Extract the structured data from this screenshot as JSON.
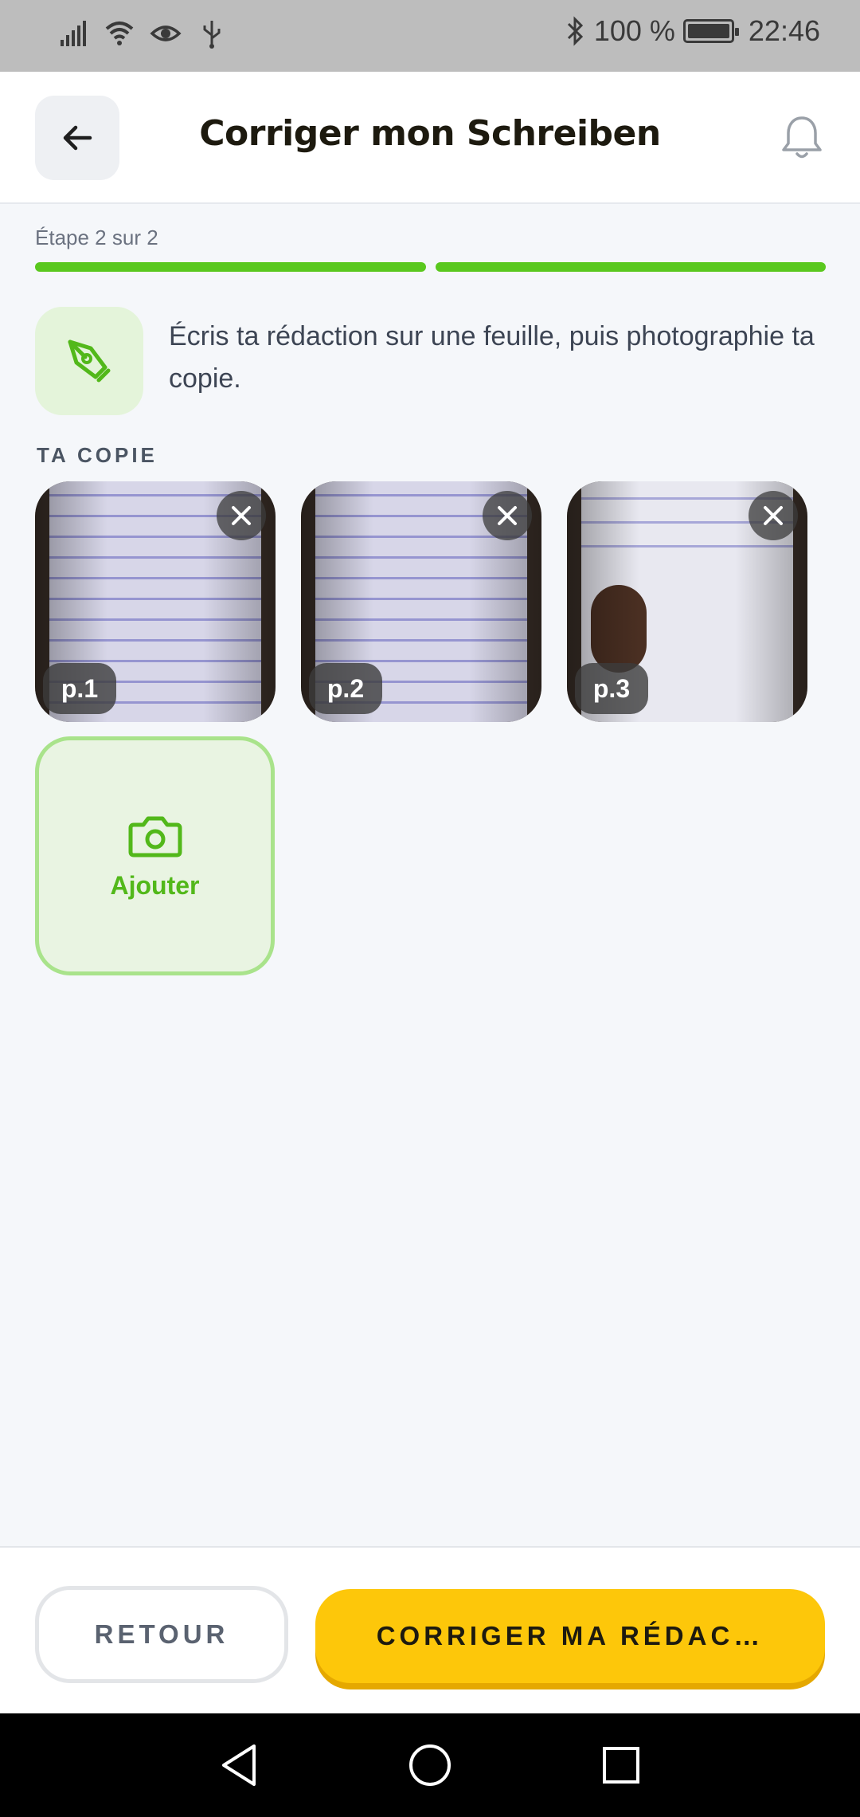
{
  "status_bar": {
    "battery": "100 %",
    "time": "22:46",
    "icons": [
      "signal-icon",
      "wifi-icon",
      "eye-icon",
      "usb-icon",
      "bluetooth-icon",
      "battery-icon"
    ]
  },
  "header": {
    "title": "Corriger mon Schreiben",
    "back_icon": "arrow-left-icon",
    "notification_icon": "bell-icon"
  },
  "step": {
    "label": "Étape 2 sur 2",
    "current": 2,
    "total": 2
  },
  "instruction": {
    "icon": "pen-nib-icon",
    "text": "Écris ta rédaction sur une feuille, puis photographie ta copie."
  },
  "copy_section": {
    "label": "TA COPIE",
    "pages": [
      {
        "badge": "p.1"
      },
      {
        "badge": "p.2"
      },
      {
        "badge": "p.3"
      }
    ],
    "add_label": "Ajouter",
    "add_icon": "camera-icon"
  },
  "actions": {
    "back_label": "RETOUR",
    "submit_label": "CORRIGER MA RÉDAC…"
  },
  "colors": {
    "accent_green": "#5ac81e",
    "submit_yellow": "#fdc70a",
    "header_bg": "#ffffff",
    "page_bg": "#f5f7fa"
  }
}
